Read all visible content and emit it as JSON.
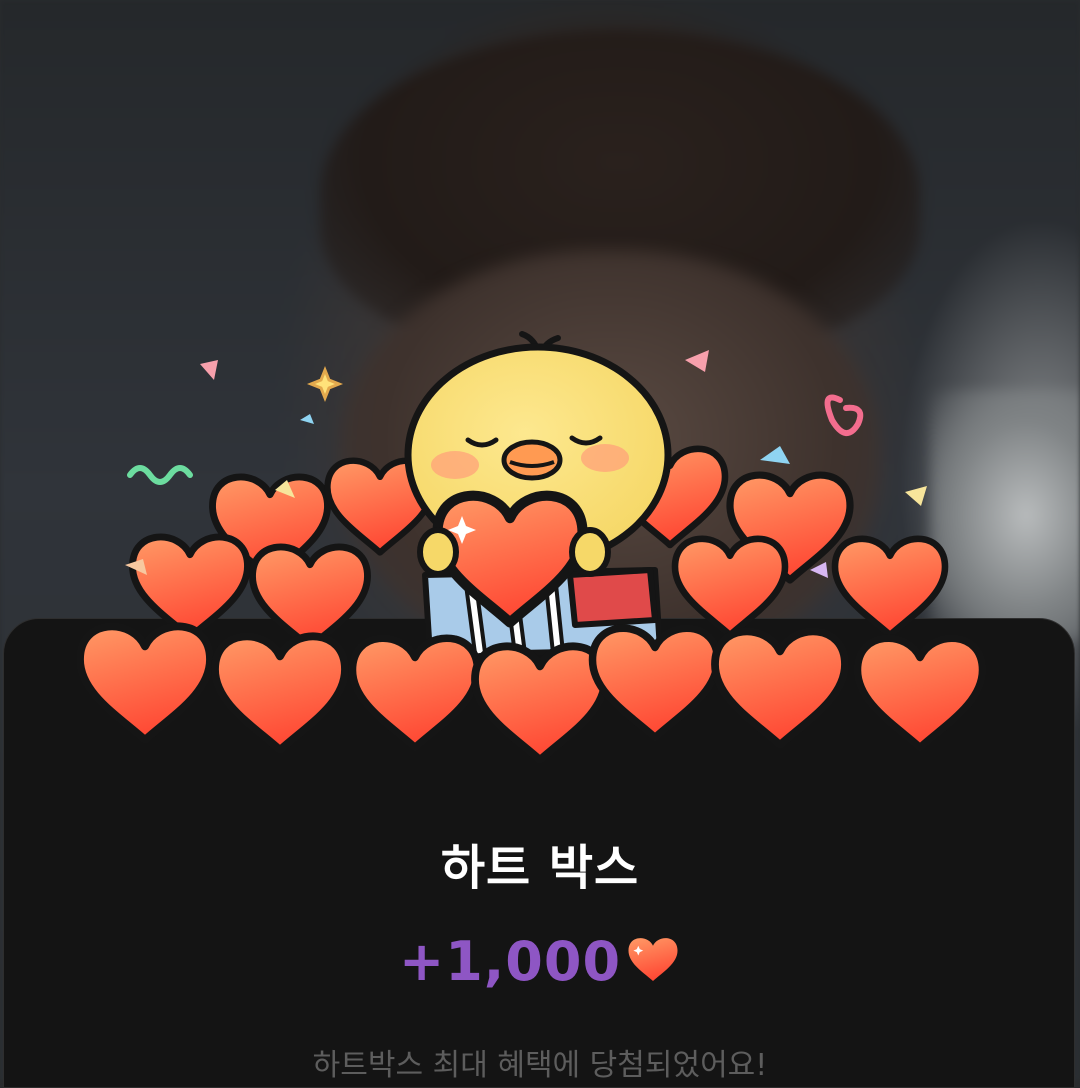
{
  "reward": {
    "title": "하트 박스",
    "amount": "+1,000",
    "amount_icon": "heart-icon",
    "message": "하트박스 최대 혜택에 당첨되었어요!"
  },
  "illustration": {
    "name": "duck-with-hearts",
    "colors": {
      "heart_top": "#ff8a5c",
      "heart_bottom": "#ff4f3a",
      "duck_body": "#fbe27c",
      "box": "#a9cbe9",
      "outline": "#141414"
    }
  },
  "colors": {
    "sheet_bg": "#141414",
    "title": "#ffffff",
    "amount": "#8e56c4",
    "message": "#5d5d5d"
  }
}
